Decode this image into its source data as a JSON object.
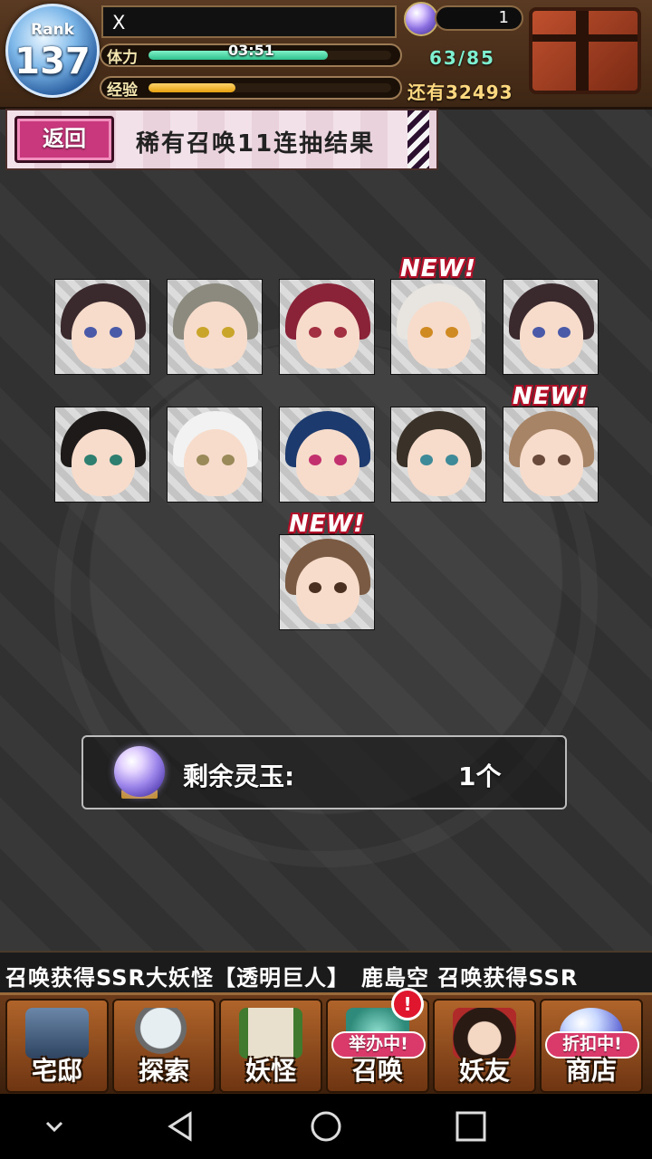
{
  "status": {
    "rank_label": "Rank",
    "rank_value": "137",
    "player_name": "X",
    "stamina_label": "体力",
    "stamina_timer": "03:51",
    "stamina_value": "63/85",
    "stamina_fraction": 0.74,
    "exp_label": "经验",
    "exp_fraction": 0.36,
    "exp_remaining": "还有32493",
    "orb_count": "1"
  },
  "header": {
    "back_label": "返回",
    "title": "稀有召唤11连抽结果"
  },
  "results": [
    {
      "new": false,
      "hair": "#3a2a2e",
      "eye": "#4a5aa8"
    },
    {
      "new": false,
      "hair": "#8c8a7e",
      "eye": "#c9a52a"
    },
    {
      "new": false,
      "hair": "#8a2338",
      "eye": "#a23040"
    },
    {
      "new": true,
      "hair": "#e8e4e0",
      "eye": "#d08a22"
    },
    {
      "new": false,
      "hair": "#3a2a2e",
      "eye": "#4a5aa8"
    },
    {
      "new": false,
      "hair": "#1f1a1a",
      "eye": "#2f7f70"
    },
    {
      "new": false,
      "hair": "#f2f2f2",
      "eye": "#9a8a5a"
    },
    {
      "new": false,
      "hair": "#1d3a6e",
      "eye": "#c2306e"
    },
    {
      "new": false,
      "hair": "#3a3128",
      "eye": "#3f8a98"
    },
    {
      "new": true,
      "hair": "#a88466",
      "eye": "#6a4a3a"
    },
    {
      "new": true,
      "hair": "#7a5a42",
      "eye": "#4a3020"
    }
  ],
  "new_badge": "NEW!",
  "remaining": {
    "label": "剩余灵玉:",
    "count": "1个"
  },
  "ticker": "召唤获得SSR大妖怪【透明巨人】　鹿島空 召唤获得SSR",
  "nav": [
    {
      "label": "宅邸",
      "icon": "house-icon",
      "tag": ""
    },
    {
      "label": "探索",
      "icon": "magnifier-icon",
      "tag": ""
    },
    {
      "label": "妖怪",
      "icon": "scroll-icon",
      "tag": ""
    },
    {
      "label": "召唤",
      "icon": "summon-icon",
      "tag": "举办中!",
      "alert": "!"
    },
    {
      "label": "妖友",
      "icon": "friend-icon",
      "tag": ""
    },
    {
      "label": "商店",
      "icon": "orb-shop-icon",
      "tag": "折扣中!"
    }
  ],
  "colors": {
    "accent_pink": "#c9387d",
    "stamina": "#2fbf8e",
    "exp": "#e6a10f",
    "new_red": "#b3102a"
  }
}
